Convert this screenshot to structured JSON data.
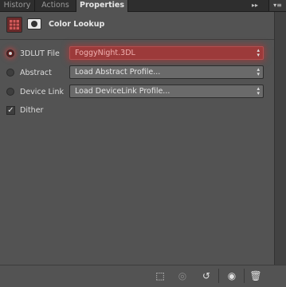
{
  "tabs": [
    {
      "label": "History",
      "active": false
    },
    {
      "label": "Actions",
      "active": false
    },
    {
      "label": "Properties",
      "active": true
    }
  ],
  "tabbar_icons": {
    "collapse": "double-chevron-right-icon",
    "menu": "panel-menu-icon",
    "collapse_glyph": "▸▸",
    "menu_glyph": "▾≡"
  },
  "header": {
    "title": "Color Lookup",
    "adjustment_icon": "color-lookup-grid-icon",
    "mask_icon": "layer-mask-icon"
  },
  "rows": {
    "lut": {
      "label": "3DLUT File",
      "selected": true,
      "value": "FoggyNight.3DL"
    },
    "abstract": {
      "label": "Abstract",
      "selected": false,
      "value": "Load Abstract Profile..."
    },
    "device_link": {
      "label": "Device Link",
      "selected": false,
      "value": "Load DeviceLink Profile..."
    }
  },
  "dither": {
    "label": "Dither",
    "checked": true,
    "check_glyph": "✓"
  },
  "select_arrows": "▲▼",
  "footer": [
    {
      "name": "clip-to-layer-icon",
      "glyph": "⬚",
      "dim": false
    },
    {
      "name": "view-previous-state-icon",
      "glyph": "◎",
      "dim": true
    },
    {
      "name": "reset-icon",
      "glyph": "↺",
      "dim": false
    },
    {
      "name": "visibility-eye-icon",
      "glyph": "◉",
      "dim": false
    },
    {
      "name": "trash-icon",
      "glyph": "🗑",
      "dim": false
    }
  ],
  "colors": {
    "panel_bg": "#535353",
    "accent_red": "#9c3a3a",
    "text": "#d8d8d8"
  }
}
